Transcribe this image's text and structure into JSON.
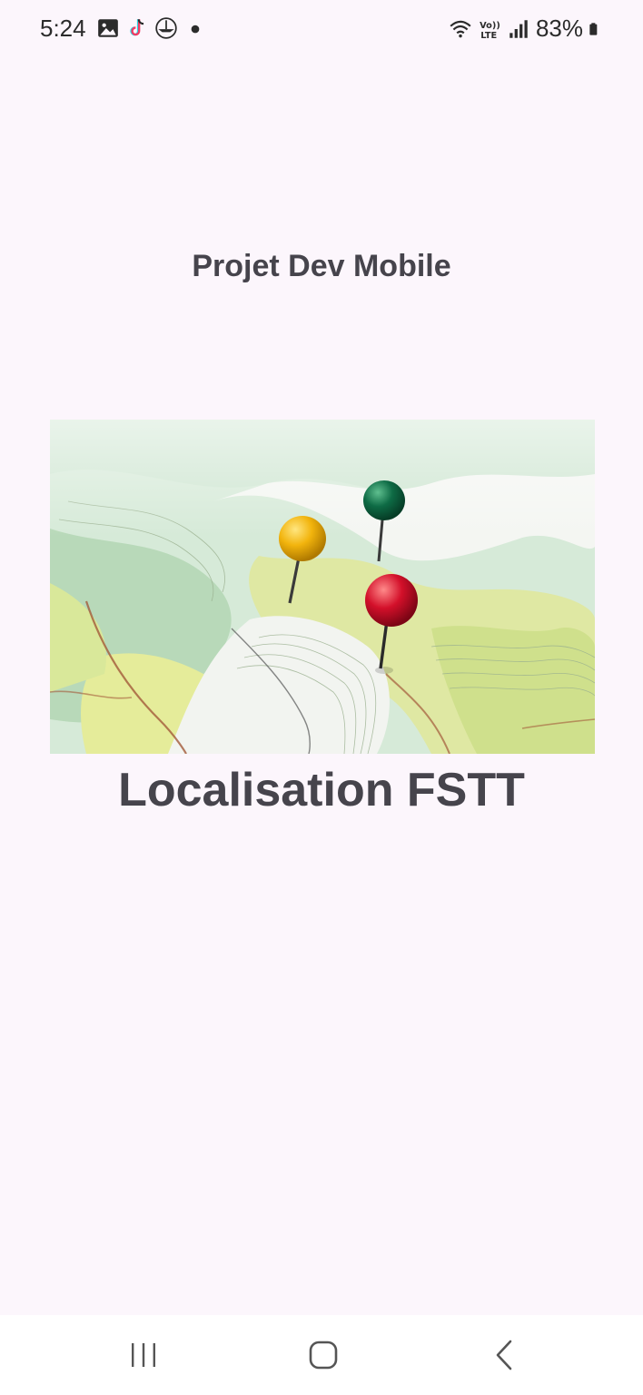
{
  "status_bar": {
    "time": "5:24",
    "battery": "83%",
    "left_icons": [
      "gallery-icon",
      "tiktok-icon",
      "app-icon",
      "dot-icon"
    ],
    "right_icons": [
      "wifi-icon",
      "volte-icon",
      "signal-icon",
      "battery-icon"
    ]
  },
  "app": {
    "title": "Projet Dev Mobile",
    "heading": "Localisation FSTT"
  },
  "image": {
    "subject": "map-with-pins",
    "pin_colors": [
      "#f2b40d",
      "#0e6b45",
      "#d3102a"
    ]
  },
  "nav_bar": {
    "buttons": [
      "recents-button",
      "home-button",
      "back-button"
    ]
  }
}
